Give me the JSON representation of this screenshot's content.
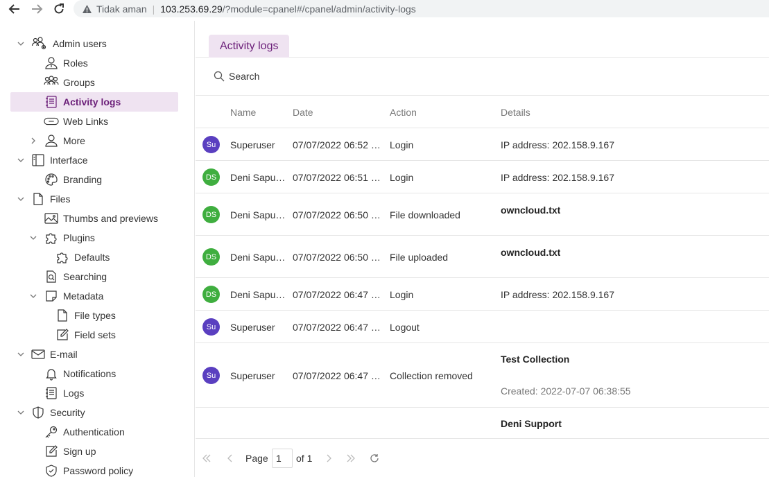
{
  "browser": {
    "security_label": "Tidak aman",
    "url_host": "103.253.69.29",
    "url_path": "/?module=cpanel#/cpanel/admin/activity-logs"
  },
  "sidebar": {
    "items": [
      {
        "label": "Admin users",
        "icon": "users-gear-icon"
      },
      {
        "label": "Roles",
        "icon": "user-badge-icon"
      },
      {
        "label": "Groups",
        "icon": "group-icon"
      },
      {
        "label": "Activity logs",
        "icon": "log-book-icon"
      },
      {
        "label": "Web Links",
        "icon": "link-icon"
      },
      {
        "label": "More",
        "icon": "user-icon"
      },
      {
        "label": "Interface",
        "icon": "layout-icon"
      },
      {
        "label": "Branding",
        "icon": "palette-icon"
      },
      {
        "label": "Files",
        "icon": "file-icon"
      },
      {
        "label": "Thumbs and previews",
        "icon": "image-icon"
      },
      {
        "label": "Plugins",
        "icon": "puzzle-icon"
      },
      {
        "label": "Defaults",
        "icon": "puzzle-icon"
      },
      {
        "label": "Searching",
        "icon": "file-search-icon"
      },
      {
        "label": "Metadata",
        "icon": "sticky-note-icon"
      },
      {
        "label": "File types",
        "icon": "file-icon"
      },
      {
        "label": "Field sets",
        "icon": "edit-icon"
      },
      {
        "label": "E-mail",
        "icon": "mail-icon"
      },
      {
        "label": "Notifications",
        "icon": "bell-icon"
      },
      {
        "label": "Logs",
        "icon": "log-book-icon"
      },
      {
        "label": "Security",
        "icon": "shield-icon"
      },
      {
        "label": "Authentication",
        "icon": "key-icon"
      },
      {
        "label": "Sign up",
        "icon": "edit-icon"
      },
      {
        "label": "Password policy",
        "icon": "shield-check-icon"
      }
    ]
  },
  "main": {
    "tab_label": "Activity logs",
    "search_label": "Search",
    "columns": [
      "Name",
      "Date",
      "Action",
      "Details"
    ],
    "rows": [
      {
        "avatar": "Su",
        "name": "Superuser",
        "date": "07/07/2022 06:52 …",
        "action": "Login",
        "details": "IP address: 202.158.9.167",
        "details2": ""
      },
      {
        "avatar": "DS",
        "name": "Deni Sapu…",
        "date": "07/07/2022 06:51 …",
        "action": "Login",
        "details": "IP address: 202.158.9.167",
        "details2": ""
      },
      {
        "avatar": "DS",
        "name": "Deni Sapu…",
        "date": "07/07/2022 06:50 …",
        "action": "File downloaded",
        "details": "owncloud.txt",
        "details2": ""
      },
      {
        "avatar": "DS",
        "name": "Deni Sapu…",
        "date": "07/07/2022 06:50 …",
        "action": "File uploaded",
        "details": "owncloud.txt",
        "details2": ""
      },
      {
        "avatar": "DS",
        "name": "Deni Sapu…",
        "date": "07/07/2022 06:47 …",
        "action": "Login",
        "details": "IP address: 202.158.9.167",
        "details2": ""
      },
      {
        "avatar": "Su",
        "name": "Superuser",
        "date": "07/07/2022 06:47 …",
        "action": "Logout",
        "details": "",
        "details2": ""
      },
      {
        "avatar": "Su",
        "name": "Superuser",
        "date": "07/07/2022 06:47 …",
        "action": "Collection removed",
        "details": "Test Collection",
        "details2": "Created: 2022-07-07 06:38:55"
      },
      {
        "avatar": "",
        "name": "",
        "date": "",
        "action": "",
        "details": "Deni Support",
        "details2": ""
      }
    ],
    "pager": {
      "page_label": "Page",
      "page_value": "1",
      "of_label": "of 1"
    }
  }
}
